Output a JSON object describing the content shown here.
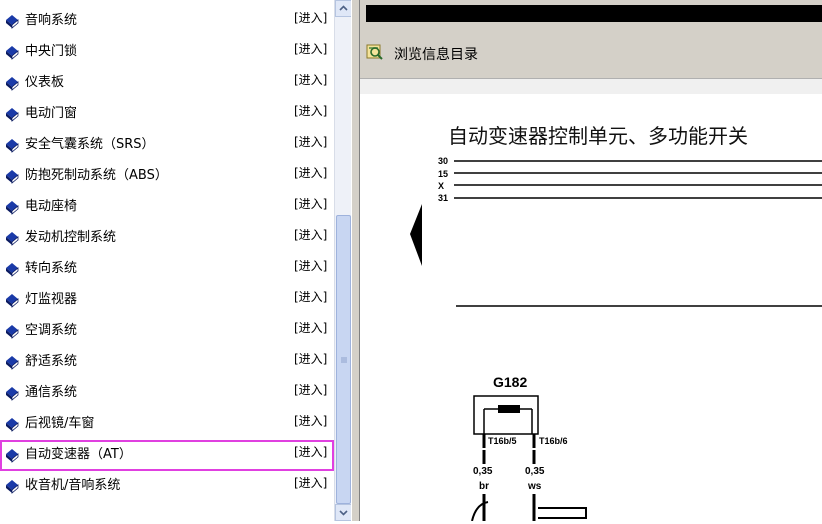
{
  "list": {
    "enter_label": "[进入]",
    "items": [
      {
        "label": "音响系统"
      },
      {
        "label": "中央门锁"
      },
      {
        "label": "仪表板"
      },
      {
        "label": "电动门窗"
      },
      {
        "label": "安全气囊系统（SRS）"
      },
      {
        "label": "防抱死制动系统（ABS）"
      },
      {
        "label": "电动座椅"
      },
      {
        "label": "发动机控制系统"
      },
      {
        "label": "转向系统"
      },
      {
        "label": "灯监视器"
      },
      {
        "label": "空调系统"
      },
      {
        "label": "舒适系统"
      },
      {
        "label": "通信系统"
      },
      {
        "label": "后视镜/车窗"
      },
      {
        "label": "自动变速器（AT）",
        "selected": true
      },
      {
        "label": "收音机/音响系统"
      }
    ]
  },
  "toolbar": {
    "browse_label": "浏览信息目录"
  },
  "document": {
    "title": "自动变速器控制单元、多功能开关",
    "bus_lines": [
      "30",
      "15",
      "X",
      "31"
    ],
    "component": "G182",
    "connector_left": "T16b/5",
    "connector_right": "T16b/6",
    "wire_left_size": "0,35",
    "wire_left_color": "br",
    "wire_right_size": "0,35",
    "wire_right_color": "ws"
  },
  "colors": {
    "selection_outline": "#e040e0",
    "book_icon": "#1a3aa8"
  }
}
